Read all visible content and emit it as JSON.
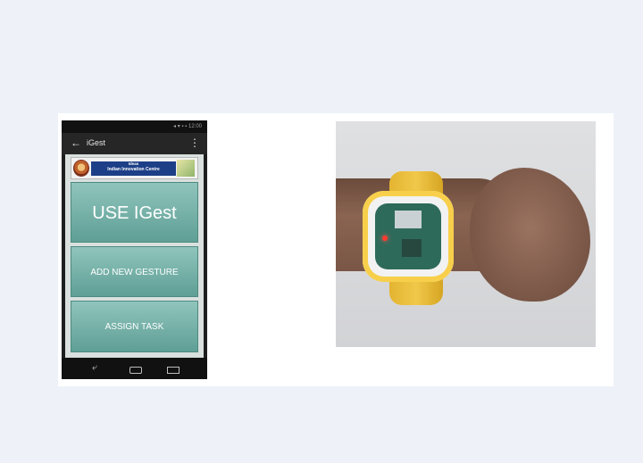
{
  "phone": {
    "status": "◂ ▾ ▪ ▪ 12:00",
    "appbar": {
      "back": "←",
      "title": "iGest",
      "menu": "⋮"
    },
    "banner": {
      "line1": "Ideas",
      "line2": "Indian Innovation Centre"
    },
    "buttons": {
      "use": "USE IGest",
      "add": "ADD NEW GESTURE",
      "assign": "ASSIGN TASK"
    },
    "navbar": {
      "back": "⤶"
    }
  },
  "photo": {
    "subject": "wrist-worn smartwatch prototype on arm"
  },
  "icons": [
    "back-arrow-icon",
    "overflow-menu-icon",
    "home-icon",
    "recent-apps-icon"
  ]
}
